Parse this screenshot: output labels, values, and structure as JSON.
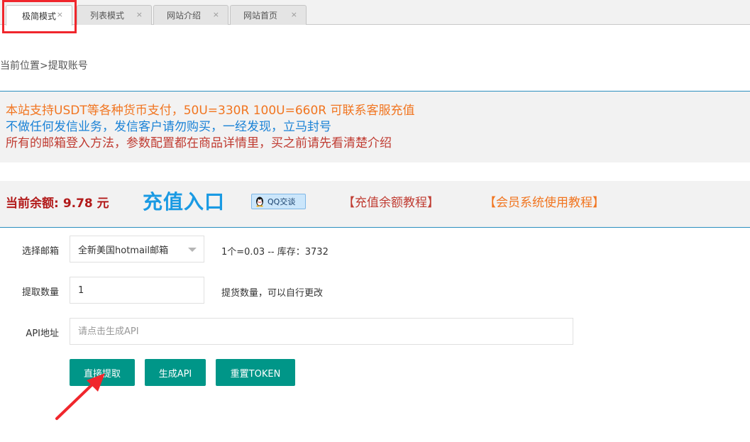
{
  "tabs": [
    {
      "label": "极简模式",
      "close": "×"
    },
    {
      "label": "列表模式",
      "close": "×"
    },
    {
      "label": "网站介绍",
      "close": "×"
    },
    {
      "label": "网站首页",
      "close": "×"
    }
  ],
  "breadcrumb": "当前位置>提取账号",
  "notice": {
    "line1": "本站支持USDT等各种货币支付，50U=330R 100U=660R  可联系客服充值",
    "line2": "不做任何发信业务，发信客户请勿购买，一经发现，立马封号",
    "line3": "所有的邮箱登入方法，参数配置都在商品详情里，买之前请先看清楚介绍"
  },
  "balance": {
    "label": "当前余额:",
    "amount": "9.78  元",
    "recharge": "充值入口",
    "qq": "QQ交谈",
    "tutorial_recharge": "【充值余额教程】",
    "tutorial_member": "【会员系统使用教程】"
  },
  "form": {
    "email_label": "选择邮箱",
    "email_value": "全新美国hotmail邮箱",
    "email_hint": "1个=0.03 -- 库存：3732",
    "quantity_label": "提取数量",
    "quantity_value": "1",
    "quantity_hint": "提货数量，可以自行更改",
    "api_label": "API地址",
    "api_placeholder": "请点击生成API"
  },
  "buttons": {
    "extract": "直接提取",
    "gen_api": "生成API",
    "reset_token": "重置TOKEN"
  },
  "colors": {
    "accent": "#009688",
    "highlight": "#f0262c",
    "orange": "#f17520",
    "blue": "#1a82d6",
    "red": "#c03c32"
  }
}
